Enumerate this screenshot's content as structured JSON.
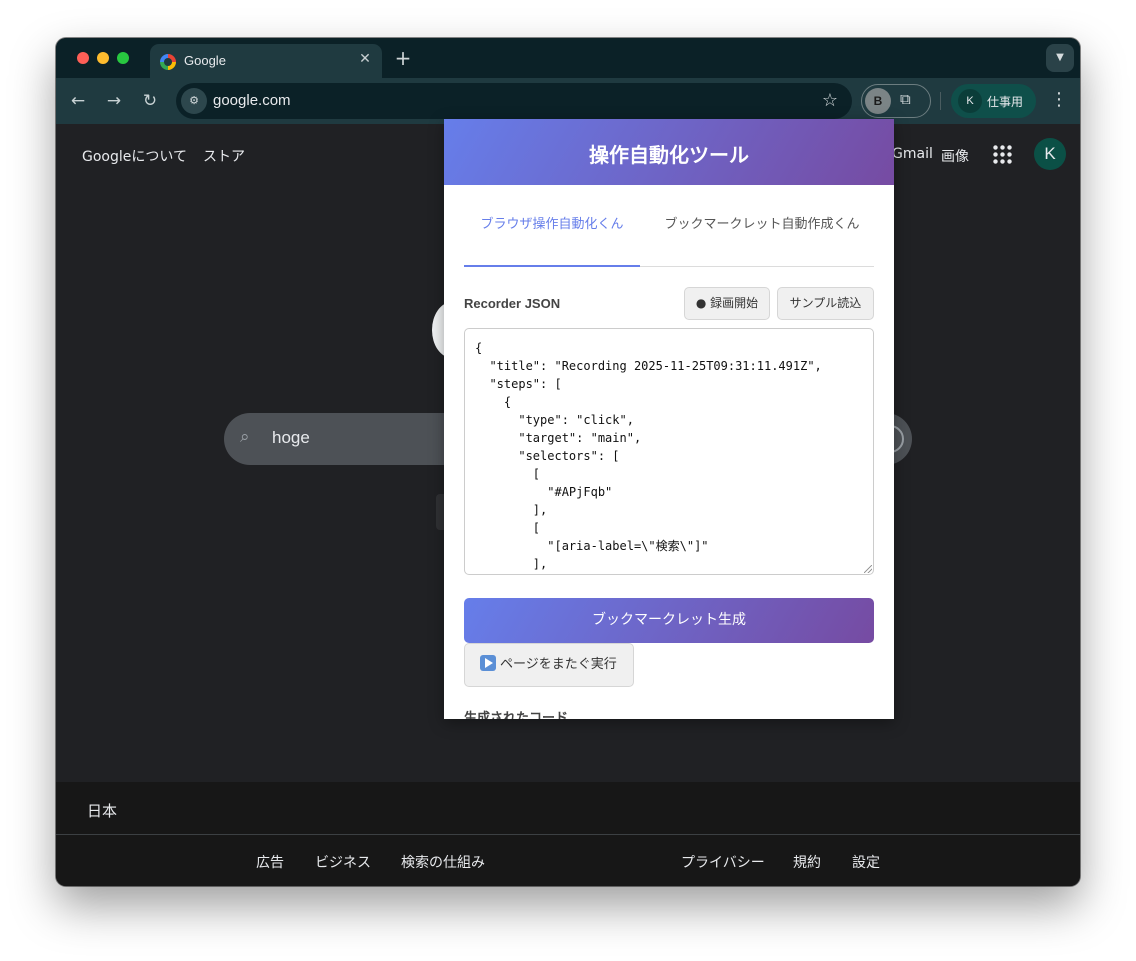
{
  "browser": {
    "tab_title": "Google",
    "tab_close": "✕",
    "new_tab": "+",
    "tab_menu": "▼",
    "url": "google.com",
    "profile_initial": "B",
    "account_chip_initial": "K",
    "account_chip_label": "仕事用",
    "icons": {
      "back": "back-arrow-icon",
      "forward": "forward-arrow-icon",
      "reload": "reload-icon",
      "site_info": "tune-icon",
      "bookmark": "star-icon",
      "extensions": "puzzle-icon",
      "menu": "kebab-icon"
    }
  },
  "google": {
    "top_left_links": [
      "Googleについて",
      "ストア"
    ],
    "top_right_links": [
      "Gmail",
      "画像"
    ],
    "account_initial": "K",
    "search_query": "hoge",
    "footer_country": "日本",
    "footer_left_links": [
      "広告",
      "ビジネス",
      "検索の仕組み"
    ],
    "footer_right_links": [
      "プライバシー",
      "規約",
      "設定"
    ]
  },
  "popup": {
    "title": "操作自動化ツール",
    "tabs": [
      {
        "label": "ブラウザ操作自動化くん",
        "active": true
      },
      {
        "label": "ブックマークレット自動作成くん",
        "active": false
      }
    ],
    "section_label": "Recorder JSON",
    "record_button": "● 録画開始",
    "sample_button": "サンプル読込",
    "json_text": "{\n  \"title\": \"Recording 2025-11-25T09:31:11.491Z\",\n  \"steps\": [\n    {\n      \"type\": \"click\",\n      \"target\": \"main\",\n      \"selectors\": [\n        [\n          \"#APjFqb\"\n        ],\n        [\n          \"[aria-label=\\\"検索\\\"]\"\n        ],",
    "generate_button": "ブックマークレット生成",
    "run_button": "ページをまたぐ実行",
    "generated_code_label": "生成されたコード",
    "accent_start": "#667eea",
    "accent_end": "#764ba2"
  }
}
